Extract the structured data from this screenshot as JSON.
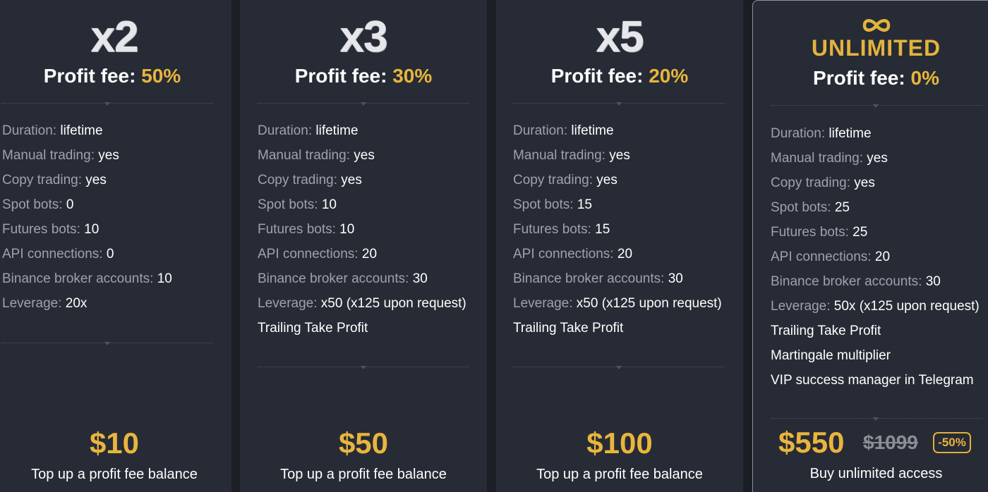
{
  "plans": [
    {
      "multiplier": "x2",
      "fee_label": "Profit fee:",
      "fee_value": "50%",
      "features": [
        {
          "key": "Duration:",
          "value": "lifetime"
        },
        {
          "key": "Manual trading:",
          "value": "yes"
        },
        {
          "key": "Copy trading:",
          "value": "yes"
        },
        {
          "key": "Spot bots:",
          "value": "0"
        },
        {
          "key": "Futures bots:",
          "value": "10"
        },
        {
          "key": "API connections:",
          "value": "0"
        },
        {
          "key": "Binance broker accounts:",
          "value": "10"
        },
        {
          "key": "Leverage:",
          "value": "20x"
        }
      ],
      "extras": [],
      "price": "$10",
      "cta": "Top up a profit fee balance"
    },
    {
      "multiplier": "x3",
      "fee_label": "Profit fee:",
      "fee_value": "30%",
      "features": [
        {
          "key": "Duration:",
          "value": "lifetime"
        },
        {
          "key": "Manual trading:",
          "value": "yes"
        },
        {
          "key": "Copy trading:",
          "value": "yes"
        },
        {
          "key": "Spot bots:",
          "value": "10"
        },
        {
          "key": "Futures bots:",
          "value": "10"
        },
        {
          "key": "API connections:",
          "value": "20"
        },
        {
          "key": "Binance broker accounts:",
          "value": "30"
        },
        {
          "key": "Leverage:",
          "value": "x50 (x125 upon request)"
        }
      ],
      "extras": [
        "Trailing Take Profit"
      ],
      "price": "$50",
      "cta": "Top up a profit fee balance"
    },
    {
      "multiplier": "x5",
      "fee_label": "Profit fee:",
      "fee_value": "20%",
      "features": [
        {
          "key": "Duration:",
          "value": "lifetime"
        },
        {
          "key": "Manual trading:",
          "value": "yes"
        },
        {
          "key": "Copy trading:",
          "value": "yes"
        },
        {
          "key": "Spot bots:",
          "value": "15"
        },
        {
          "key": "Futures bots:",
          "value": "15"
        },
        {
          "key": "API connections:",
          "value": "20"
        },
        {
          "key": "Binance broker accounts:",
          "value": "30"
        },
        {
          "key": "Leverage:",
          "value": "x50 (x125 upon request)"
        }
      ],
      "extras": [
        "Trailing Take Profit"
      ],
      "price": "$100",
      "cta": "Top up a profit fee balance"
    },
    {
      "icon": "infinity-icon",
      "title": "UNLIMITED",
      "fee_label": "Profit fee:",
      "fee_value": "0%",
      "features": [
        {
          "key": "Duration:",
          "value": "lifetime"
        },
        {
          "key": "Manual trading:",
          "value": "yes"
        },
        {
          "key": "Copy trading:",
          "value": "yes"
        },
        {
          "key": "Spot bots:",
          "value": "25"
        },
        {
          "key": "Futures bots:",
          "value": "25"
        },
        {
          "key": "API connections:",
          "value": "20"
        },
        {
          "key": "Binance broker accounts:",
          "value": "30"
        },
        {
          "key": "Leverage:",
          "value": "50x (x125 upon request)"
        }
      ],
      "extras": [
        "Trailing Take Profit",
        "Martingale multiplier",
        "VIP success manager in Telegram"
      ],
      "price": "$550",
      "old_price": "$1099",
      "discount": "-50%",
      "cta": "Buy unlimited access"
    }
  ],
  "colors": {
    "background": "#1b1e25",
    "card": "#272b35",
    "gold": "#e8b53d",
    "muted": "#9ea2ab",
    "text": "#ffffff"
  }
}
